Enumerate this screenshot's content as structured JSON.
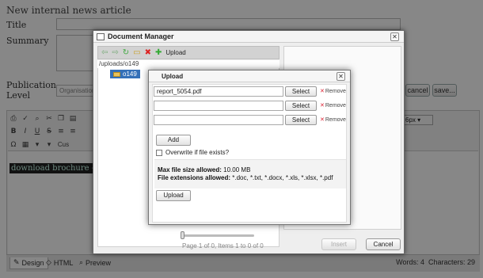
{
  "page": {
    "title": "New internal news article",
    "labels": {
      "title": "Title",
      "summary": "Summary",
      "publication_level_line1": "Publication",
      "publication_level_line2": "Level"
    },
    "publication_level_value": "Organisation",
    "buttons": {
      "cancel": "cancel",
      "save": "save..."
    }
  },
  "editor": {
    "font_size_value": "6px",
    "content_text": "download brochure - click here",
    "tabs": {
      "design": "Design",
      "html": "HTML",
      "preview": "Preview"
    },
    "status": {
      "words": "Words: 4",
      "characters": "Characters: 29"
    },
    "font_family_partial": "Cus"
  },
  "document_manager": {
    "title": "Document Manager",
    "toolbar": {
      "upload_label": "Upload"
    },
    "path": "/uploads/o149",
    "folder": "o149",
    "pager_text": "Page 1 of 0, Items 1 to 0 of 0",
    "buttons": {
      "insert": "Insert",
      "cancel": "Cancel"
    }
  },
  "upload_dialog": {
    "title": "Upload",
    "files": [
      {
        "value": "report_5054.pdf"
      },
      {
        "value": ""
      },
      {
        "value": ""
      }
    ],
    "select_label": "Select",
    "remove_label": "Remove",
    "add_label": "Add",
    "overwrite_label": "Overwrite if file exists?",
    "overwrite_checked": false,
    "max_size_label": "Max file size allowed:",
    "max_size_value": "10.00 MB",
    "extensions_label": "File extensions allowed:",
    "extensions_value": "*.doc, *.txt, *.docx, *.xls, *.xlsx, *.pdf",
    "upload_label": "Upload"
  },
  "colors": {
    "selection_blue": "#3470b8",
    "remove_red": "#dd2233",
    "overlay": "rgba(0,0,0,0.47)"
  }
}
